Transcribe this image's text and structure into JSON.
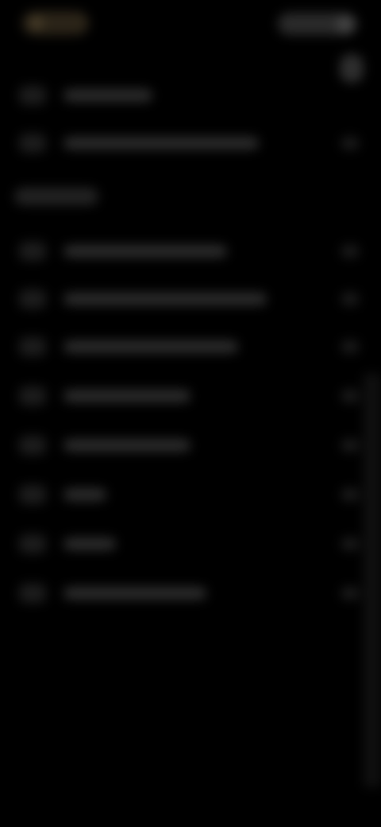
{
  "screen": {
    "state": "blurred"
  },
  "colors": {
    "background": "#000000",
    "bar": "#2c2c2c",
    "accent_glow": "#4a3f2a"
  },
  "top_rows": [
    {
      "bar_width": 112
    },
    {
      "bar_width": 246
    }
  ],
  "section_rows": [
    {
      "bar_width": 206
    },
    {
      "bar_width": 256
    },
    {
      "bar_width": 220
    },
    {
      "bar_width": 160
    },
    {
      "bar_width": 160
    },
    {
      "bar_width": 54
    },
    {
      "bar_width": 66
    },
    {
      "bar_width": 180
    }
  ],
  "icons": {
    "left": "app-logo-icon",
    "right": "avatar-icon",
    "side": "overflow-icon"
  }
}
